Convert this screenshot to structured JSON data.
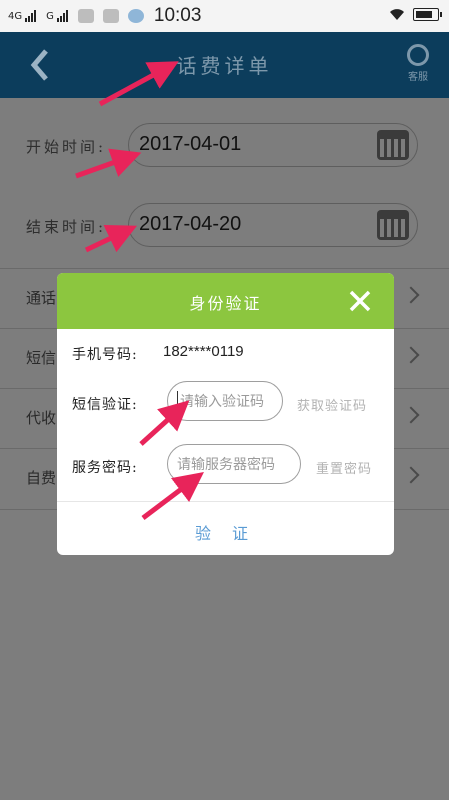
{
  "status_bar": {
    "net1": "4G",
    "net2": "G",
    "time": "10:03"
  },
  "header": {
    "back_icon": "chevron-left-icon",
    "title": "话费详单",
    "service_label": "客服"
  },
  "form": {
    "start_label": "开始时间:",
    "start_value": "2017-04-01",
    "end_label": "结束时间:",
    "end_value": "2017-04-20",
    "rows": [
      "通话",
      "短信",
      "代收",
      "自费"
    ]
  },
  "dialog": {
    "title": "身份验证",
    "close_icon": "close-icon",
    "phone_label": "手机号码:",
    "phone_value": "182****0119",
    "sms_label": "短信验证:",
    "sms_placeholder": "请输入验证码",
    "get_code": "获取验证码",
    "pwd_label": "服务密码:",
    "pwd_placeholder": "请输服务器密码",
    "reset_pwd": "重置密码",
    "verify_button": "验 证"
  },
  "colors": {
    "header_bg": "#0c3d5c",
    "dialog_header": "#8cc63f",
    "annotation_arrow": "#e8245a",
    "verify_text": "#5a9bd4"
  }
}
